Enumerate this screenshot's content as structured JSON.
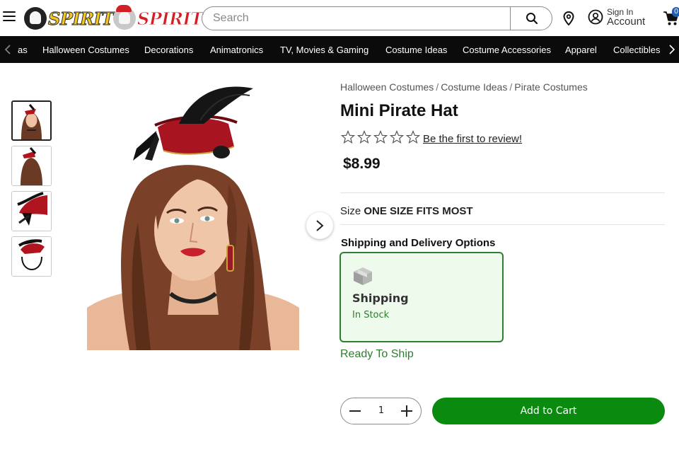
{
  "header": {
    "logo_left": "SPIRIT",
    "logo_right": "SPIRIT",
    "search_placeholder": "Search",
    "sign_in": "Sign In",
    "account": "Account",
    "cart_count": "0"
  },
  "nav": {
    "partial_item": "as",
    "items": [
      "Halloween Costumes",
      "Decorations",
      "Animatronics",
      "TV, Movies & Gaming",
      "Costume Ideas",
      "Costume Accessories",
      "Apparel",
      "Collectibles"
    ]
  },
  "breadcrumb": [
    "Halloween Costumes",
    "Costume Ideas",
    "Pirate Costumes"
  ],
  "product": {
    "title": "Mini Pirate Hat",
    "review_link": "Be the first to review!",
    "rating": 0,
    "rating_max": 5,
    "price": "$8.99",
    "size_label": "Size",
    "size_value": "ONE SIZE FITS MOST"
  },
  "shipping": {
    "heading": "Shipping and Delivery Options",
    "card_label": "Shipping",
    "card_status": "In Stock",
    "ready_text": "Ready To Ship"
  },
  "cart": {
    "quantity": "1",
    "add_label": "Add to Cart"
  },
  "colors": {
    "accent_green": "#0b8a10",
    "nav_background": "#0b0b0b",
    "logo_yellow": "#f3c623",
    "logo_red": "#d21f26"
  }
}
